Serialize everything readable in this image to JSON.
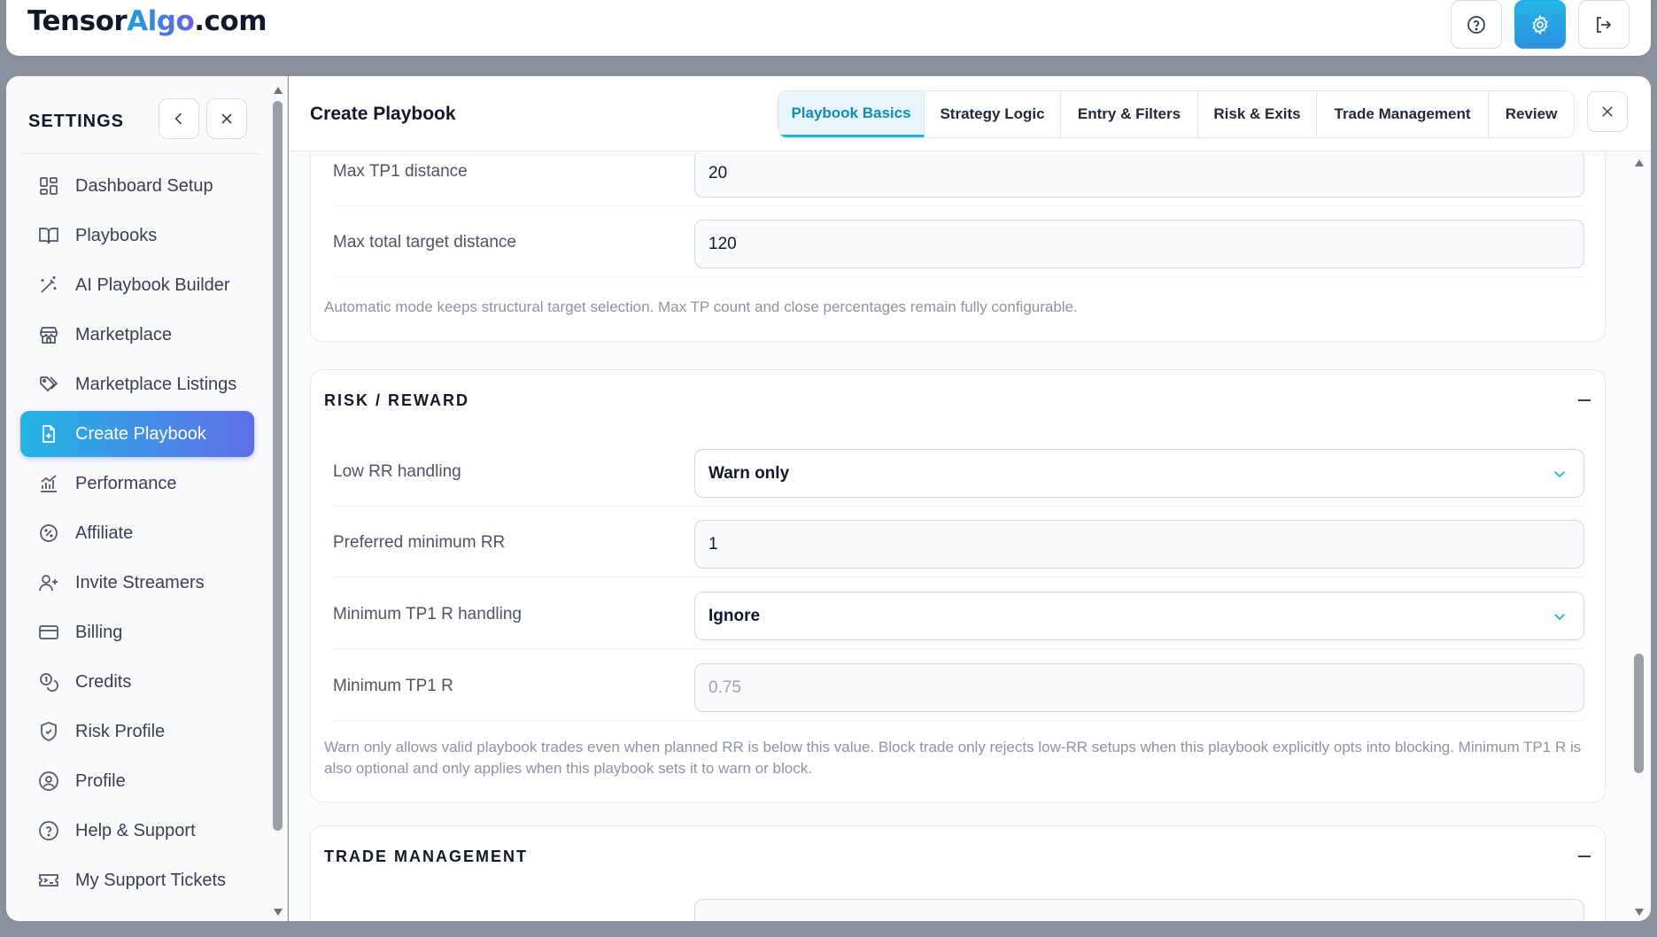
{
  "app": {
    "logo_part1": "Tensor",
    "logo_part2": "Algo",
    "logo_part3": ".com"
  },
  "topbar": {
    "icons": [
      "help-icon",
      "gear-icon",
      "logout-icon"
    ]
  },
  "sidebar": {
    "title": "SETTINGS",
    "items": [
      {
        "label": "Dashboard Setup",
        "icon": "dashboard-icon"
      },
      {
        "label": "Playbooks",
        "icon": "book-icon"
      },
      {
        "label": "AI Playbook Builder",
        "icon": "magic-wand-icon"
      },
      {
        "label": "Marketplace",
        "icon": "store-icon"
      },
      {
        "label": "Marketplace Listings",
        "icon": "tags-icon"
      },
      {
        "label": "Create Playbook",
        "icon": "file-plus-icon",
        "active": true
      },
      {
        "label": "Performance",
        "icon": "chart-icon"
      },
      {
        "label": "Affiliate",
        "icon": "badge-percent-icon"
      },
      {
        "label": "Invite Streamers",
        "icon": "user-plus-icon"
      },
      {
        "label": "Billing",
        "icon": "credit-card-icon"
      },
      {
        "label": "Credits",
        "icon": "coins-icon"
      },
      {
        "label": "Risk Profile",
        "icon": "shield-icon"
      },
      {
        "label": "Profile",
        "icon": "user-circle-icon"
      },
      {
        "label": "Help & Support",
        "icon": "help-circle-icon"
      },
      {
        "label": "My Support Tickets",
        "icon": "ticket-icon"
      }
    ]
  },
  "main": {
    "title": "Create Playbook",
    "tabs": [
      {
        "label": "Playbook Basics",
        "active": true
      },
      {
        "label": "Strategy Logic"
      },
      {
        "label": "Entry & Filters"
      },
      {
        "label": "Risk & Exits"
      },
      {
        "label": "Trade Management"
      },
      {
        "label": "Review"
      }
    ]
  },
  "targets_section": {
    "rows": [
      {
        "label": "Max TP1 distance",
        "value": "20"
      },
      {
        "label": "Max total target distance",
        "value": "120"
      }
    ],
    "note": "Automatic mode keeps structural target selection. Max TP count and close percentages remain fully configurable."
  },
  "risk_reward": {
    "title": "RISK / REWARD",
    "rows": [
      {
        "label": "Low RR handling",
        "value": "Warn only"
      },
      {
        "label": "Preferred minimum RR",
        "value": "1"
      },
      {
        "label": "Minimum TP1 R handling",
        "value": "Ignore"
      },
      {
        "label": "Minimum TP1 R",
        "value": "0.75"
      }
    ],
    "note": "Warn only allows valid playbook trades even when planned RR is below this value. Block trade only rejects low-RR setups when this playbook explicitly opts into blocking. Minimum TP1 R is also optional and only applies when this playbook sets it to warn or block."
  },
  "trade_management": {
    "title": "TRADE MANAGEMENT"
  },
  "colors": {
    "accent_start": "#22b5e3",
    "accent_end": "#5f6ee8",
    "active_tab_text": "#1689b3"
  }
}
